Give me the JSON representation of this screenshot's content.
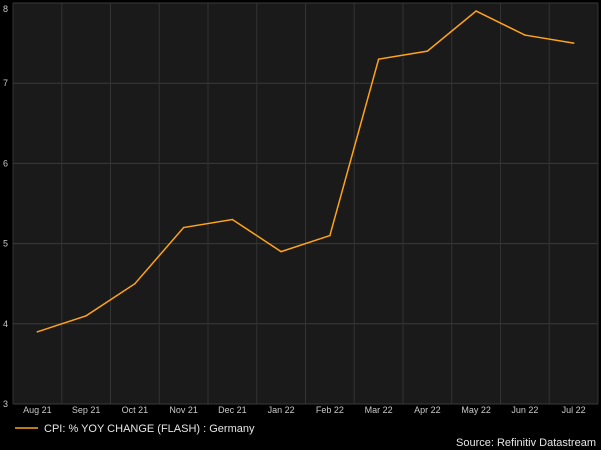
{
  "chart_data": {
    "type": "line",
    "title": "",
    "xlabel": "",
    "ylabel": "",
    "categories": [
      "Aug 21",
      "Sep 21",
      "Oct 21",
      "Nov 21",
      "Dec 21",
      "Jan 22",
      "Feb 22",
      "Mar 22",
      "Apr 22",
      "May 22",
      "Jun 22",
      "Jul 22"
    ],
    "series": [
      {
        "name": "CPI: % YOY CHANGE (FLASH) : Germany",
        "values": [
          3.9,
          4.1,
          4.5,
          5.2,
          5.3,
          4.9,
          5.1,
          7.3,
          7.4,
          7.9,
          7.6,
          7.5
        ],
        "color": "#ffa31a"
      }
    ],
    "ylim": [
      3,
      8
    ],
    "yticks": [
      3,
      4,
      5,
      6,
      7,
      8
    ],
    "grid": true,
    "legend_position": "bottom-left",
    "source": "Source: Refinitiv Datastream",
    "background": "#1a1a1a"
  }
}
